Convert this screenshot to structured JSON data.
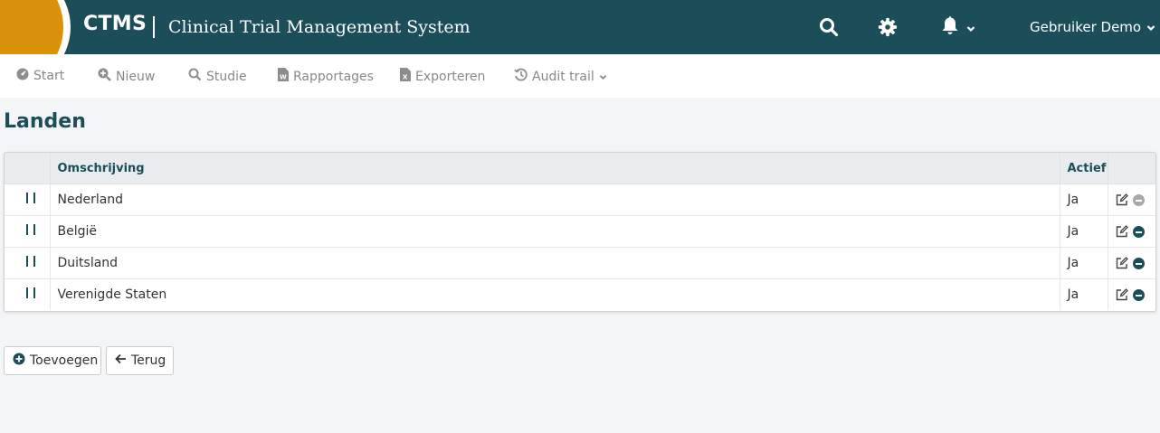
{
  "header": {
    "brand": "CTMS",
    "subtitle": "Clinical Trial Management System",
    "user_name": "Gebruiker Demo",
    "icons": [
      "search-icon",
      "gear-icon",
      "bell-icon",
      "chevron-down-icon"
    ],
    "colors": {
      "primary": "#1c4e5a",
      "accent": "#d9920a"
    }
  },
  "nav": {
    "items": [
      {
        "label": "Start",
        "icon": "dashboard-icon"
      },
      {
        "label": "Nieuw",
        "icon": "plus-search-icon"
      },
      {
        "label": "Studie",
        "icon": "search-icon"
      },
      {
        "label": "Rapportages",
        "icon": "word-file-icon"
      },
      {
        "label": "Exporteren",
        "icon": "excel-file-icon"
      },
      {
        "label": "Audit trail",
        "icon": "history-icon"
      }
    ]
  },
  "page": {
    "title": "Landen"
  },
  "table": {
    "columns": [
      "",
      "Omschrijving",
      "Actief",
      ""
    ],
    "rows": [
      {
        "omschrijving": "Nederland",
        "actief": "Ja",
        "delete_disabled": true
      },
      {
        "omschrijving": "België",
        "actief": "Ja",
        "delete_disabled": false
      },
      {
        "omschrijving": "Duitsland",
        "actief": "Ja",
        "delete_disabled": false
      },
      {
        "omschrijving": "Verenigde Staten",
        "actief": "Ja",
        "delete_disabled": false
      }
    ]
  },
  "buttons": {
    "add_label": "Toevoegen",
    "back_label": "Terug"
  }
}
